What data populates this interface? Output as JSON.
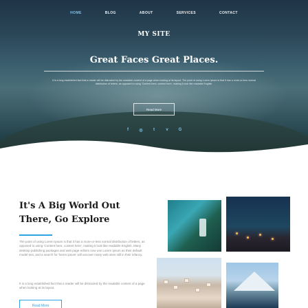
{
  "nav": {
    "items": [
      {
        "label": "Home",
        "active": true
      },
      {
        "label": "Blog",
        "active": false
      },
      {
        "label": "About",
        "active": false
      },
      {
        "label": "Services",
        "active": false
      },
      {
        "label": "Contact",
        "active": false
      }
    ]
  },
  "hero": {
    "brand": "MY SITE",
    "tagline": "Great Faces Great Places.",
    "intro": "It is a long established fact that a reader will be distracted by the readable content of a page when looking at its layout. The point of using Lorem Ipsum is that it has a more-or-less normal distribution of letters, as opposed to using 'Content here, content here', making it look like readable English.",
    "read_more": "Read More",
    "social_icons": [
      "facebook-icon",
      "instagram-icon",
      "twitter-icon",
      "vimeo-icon",
      "google-plus-icon"
    ],
    "social_glyphs": [
      "f",
      "◎",
      "t",
      "v",
      "G"
    ]
  },
  "section": {
    "title": "It's A Big World Out There, Go Explore",
    "paragraph_1": "The point of using Lorem Ipsum is that it has a more-or-less normal distribution of letters, as opposed to using 'Content here, content here', making it look like readable English. Many desktop publishing packages and web page editors now use Lorem Ipsum as their default model text, and a search for 'lorem ipsum' will uncover many web sites still in their infancy.",
    "paragraph_2": "It is a long established fact that a reader will be distracted by the readable content of a page when looking at its layout.",
    "button": "Read More"
  },
  "colors": {
    "accent": "#2ea3e6",
    "nav_active": "#7fc6f0"
  }
}
